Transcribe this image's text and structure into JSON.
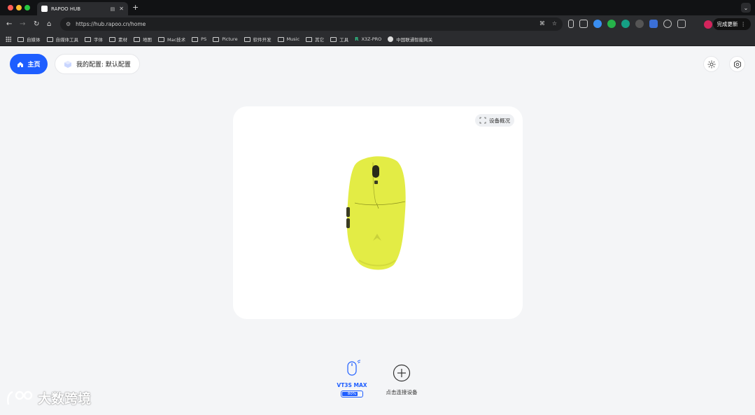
{
  "browser": {
    "tab_title": "RAPOO HUB",
    "new_tab_glyph": "+",
    "url": "https://hub.rapoo.cn/home",
    "update_label": "完成更新",
    "bookmarks": [
      "自媒体",
      "自媒体工具",
      "字体",
      "素材",
      "地图",
      "Mac技术",
      "PS",
      "Picture",
      "软件开发",
      "Music",
      "其它",
      "工具",
      "X3Z-PRO",
      "中国联通智能网关"
    ]
  },
  "header": {
    "home_label": "主页",
    "config_label": "我的配置: 默认配置"
  },
  "card": {
    "overview_label": "设备概况"
  },
  "devices": {
    "device_name": "VT3S MAX",
    "battery_text": "80%",
    "battery_level": 0.8,
    "add_label": "点击连接设备"
  },
  "watermark": {
    "text": "大数跨境"
  },
  "colors": {
    "accent": "#1e5eff",
    "mouse": "#e3ec45"
  }
}
